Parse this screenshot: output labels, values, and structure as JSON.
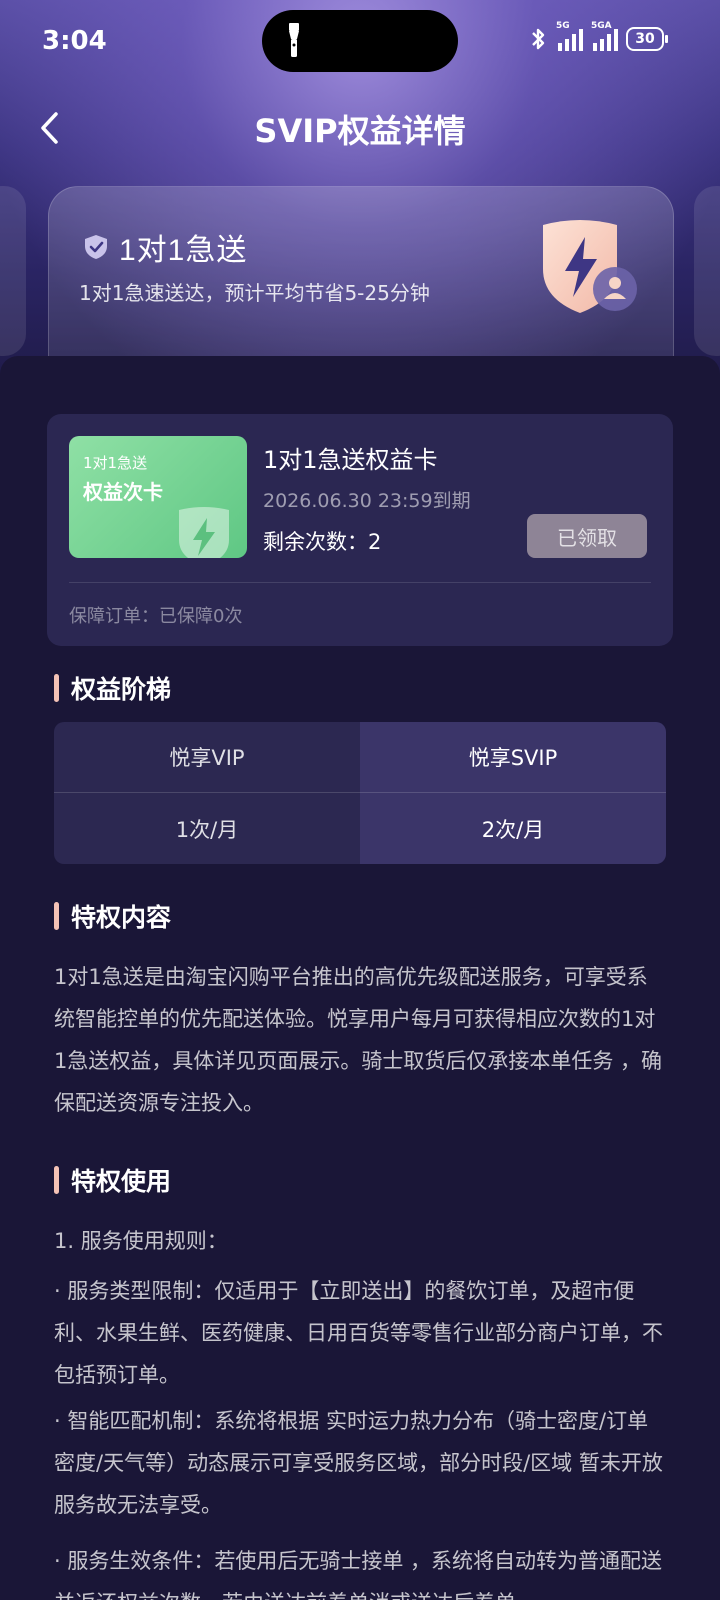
{
  "status_bar": {
    "time": "3:04",
    "signal1_label": "5G",
    "signal2_label": "5GA",
    "battery": "30"
  },
  "header": {
    "title": "SVIP权益详情"
  },
  "feature": {
    "name": "1对1急送",
    "description": "1对1急速送达，预计平均节省5-25分钟"
  },
  "quota_card": {
    "badge_small": "1对1急送",
    "badge_big": "权益次卡",
    "title": "1对1急送权益卡",
    "expiry": "2026.06.30 23:59到期",
    "remaining": "剩余次数：2",
    "button": "已领取",
    "guarantee": "保障订单：已保障0次"
  },
  "tiers": {
    "section_title": "权益阶梯",
    "vip_label": "悦享VIP",
    "svip_label": "悦享SVIP",
    "vip_value": "1次/月",
    "svip_value": "2次/月"
  },
  "privilege_content": {
    "section_title": "特权内容",
    "text": "1对1急送是由淘宝闪购平台推出的高优先级配送服务，可享受系统智能控单的优先配送体验。悦享用户每月可获得相应次数的1对1急送权益，具体详见页面展示。骑士取货后仅承接本单任务 ，确保配送资源专注投入。"
  },
  "privilege_usage": {
    "section_title": "特权使用",
    "rule_heading": "1. 服务使用规则：",
    "rule1": "· 服务类型限制：仅适用于【立即送出】的餐饮订单，及超市便利、水果生鲜、医药健康、日用百货等零售行业部分商户订单，不包括预订单。",
    "rule2": "· 智能匹配机制：系统将根据 实时运力热力分布（骑士密度/订单密度/天气等）动态展示可享受服务区域，部分时段/区域 暂未开放服务故无法享受。",
    "rule3": "· 服务生效条件：若使用后无骑士接单 ，系统将自动转为普通配送并返还权益次数，若由送达前着单消或送达后着单"
  }
}
